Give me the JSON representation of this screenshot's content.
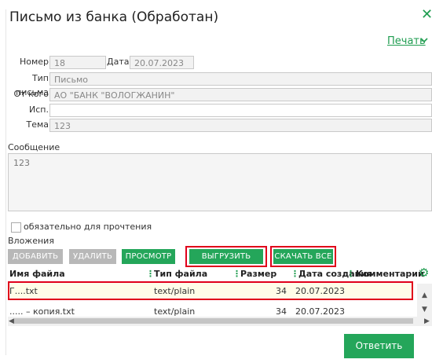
{
  "dialog": {
    "title": "Письмо из банка (Обработан)",
    "close_glyph": "✕"
  },
  "print": {
    "label": "Печать",
    "chevron": "❯"
  },
  "fields": {
    "number_label": "Номер",
    "number_value": "18",
    "date_label": "Дата",
    "date_value": "20.07.2023",
    "type_label": "Тип письма",
    "type_value": "Письмо",
    "from_label": "От кого",
    "from_value": "АО \"БАНК \"ВОЛОГЖАНИН\"",
    "executor_label": "Исп.",
    "executor_value": "",
    "subject_label": "Тема",
    "subject_value": "123"
  },
  "message": {
    "label": "Сообщение",
    "value": "123"
  },
  "required_checkbox": {
    "label": "обязательно для прочтения",
    "checked": false
  },
  "attachments": {
    "label": "Вложения",
    "buttons": {
      "add": "ДОБАВИТЬ",
      "delete": "УДАЛИТЬ",
      "view": "ПРОСМОТР",
      "export": "ВЫГРУЗИТЬ ФАЙЛ",
      "download_all": "СКАЧАТЬ ВСЕ"
    },
    "columns": [
      "Имя файла",
      "Тип файла",
      "Размер",
      "Дата создания",
      "Комментарий"
    ],
    "rows": [
      {
        "name": "Г....txt",
        "type": "text/plain",
        "size": "34",
        "date": "20.07.2023",
        "comment": ""
      },
      {
        "name": "..... – копия.txt",
        "type": "text/plain",
        "size": "34",
        "date": "20.07.2023",
        "comment": ""
      }
    ]
  },
  "icons": {
    "gear": "gear-icon",
    "close": "close-icon",
    "chevron": "chevron-down-icon"
  },
  "colors": {
    "accent": "#24a65a",
    "highlight": "#e0001b",
    "selected_row": "#fffde8"
  },
  "footer": {
    "reply": "Ответить"
  }
}
